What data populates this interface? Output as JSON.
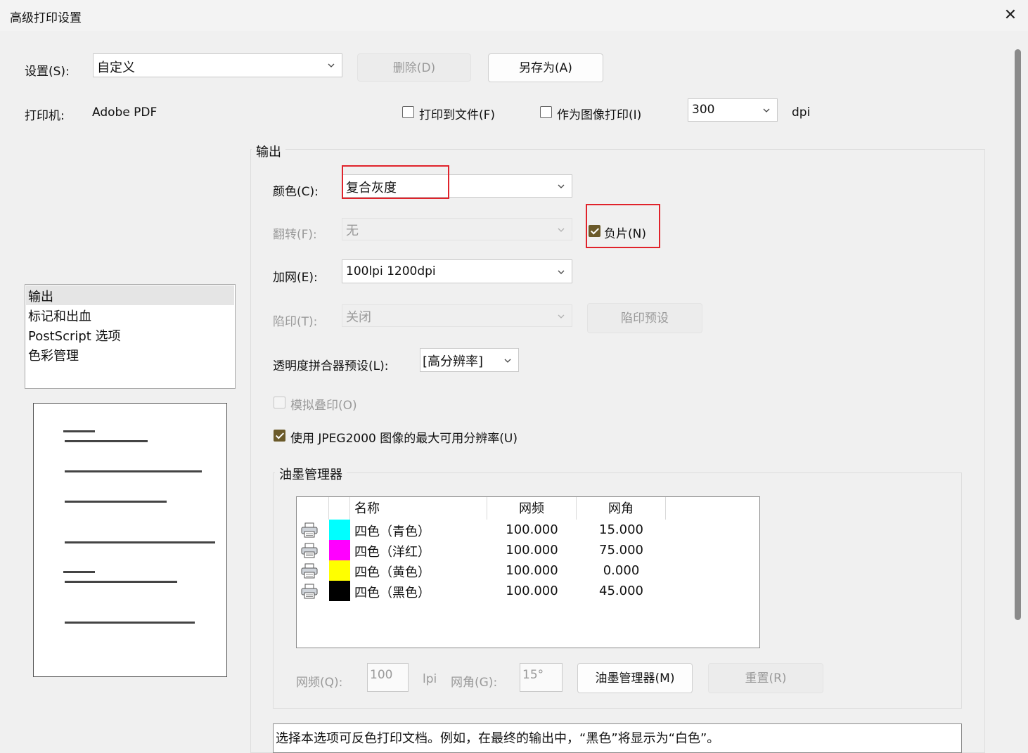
{
  "window": {
    "title": "高级打印设置",
    "close": "✕"
  },
  "settings": {
    "label": "设置(S):",
    "value": "自定义",
    "delete_label": "删除(D)",
    "save_as_label": "另存为(A)"
  },
  "printer": {
    "label": "打印机:",
    "value": "Adobe PDF",
    "print_to_file_label": "打印到文件(F)",
    "print_to_file_checked": false,
    "print_as_image_label": "作为图像打印(I)",
    "print_as_image_checked": false,
    "dpi_value": "300",
    "dpi_unit": "dpi"
  },
  "sidebar": {
    "items": [
      "输出",
      "标记和出血",
      "PostScript 选项",
      "色彩管理"
    ],
    "selected": 0
  },
  "output": {
    "group_title": "输出",
    "color_label": "颜色(C):",
    "color_value": "复合灰度",
    "flip_label": "翻转(F):",
    "flip_value": "无",
    "negative_label": "负片(N)",
    "negative_checked": true,
    "screening_label": "加网(E):",
    "screening_value": "100lpi 1200dpi",
    "trapping_label": "陷印(T):",
    "trapping_value": "关闭",
    "trap_presets_label": "陷印预设",
    "flattener_label": "透明度拼合器预设(L):",
    "flattener_value": "[高分辨率]",
    "simulate_overprint_label": "模拟叠印(O)",
    "simulate_overprint_checked": false,
    "jpeg2000_label": "使用 JPEG2000 图像的最大可用分辨率(U)",
    "jpeg2000_checked": true
  },
  "ink_manager": {
    "group_title": "油墨管理器",
    "columns": [
      "名称",
      "网频",
      "网角"
    ],
    "rows": [
      {
        "name": "四色（青色）",
        "frequency": "100.000",
        "angle": "15.000",
        "color": "#00ffff"
      },
      {
        "name": "四色（洋红）",
        "frequency": "100.000",
        "angle": "75.000",
        "color": "#ff00ff"
      },
      {
        "name": "四色（黄色）",
        "frequency": "100.000",
        "angle": "0.000",
        "color": "#ffff00"
      },
      {
        "name": "四色（黑色）",
        "frequency": "100.000",
        "angle": "45.000",
        "color": "#000000"
      }
    ],
    "frequency_label": "网频(Q):",
    "frequency_value": "100",
    "frequency_unit": "lpi",
    "angle_label": "网角(G):",
    "angle_value": "15°",
    "ink_manager_button": "油墨管理器(M)",
    "reset_button": "重置(R)"
  },
  "description": "选择本选项可反色打印文档。例如，在最终的输出中，“黑色”将显示为“白色”。",
  "colors": {
    "highlight": "#e0232b",
    "checkbox": "#6b5a2a"
  }
}
